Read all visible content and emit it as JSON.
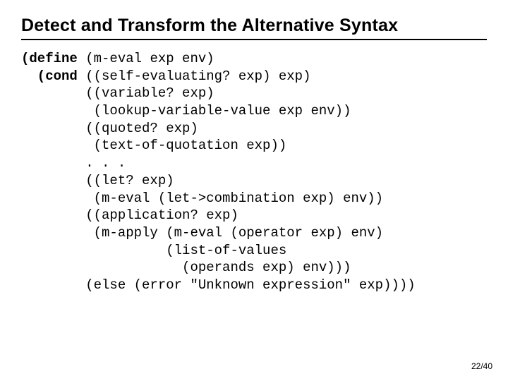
{
  "title": "Detect and Transform the Alternative Syntax",
  "code": {
    "l1a": "(define",
    "l1b": " (m-eval exp env)",
    "l2a": "  (cond",
    "l2b": " ((self-evaluating? exp) exp)",
    "l3": "        ((variable? exp)",
    "l4": "         (lookup-variable-value exp env))",
    "l5": "        ((quoted? exp)",
    "l6": "         (text-of-quotation exp))",
    "l7": "        . . .",
    "l8": "        ((let? exp)",
    "l9": "         (m-eval (let->combination exp) env))",
    "l10": "        ((application? exp)",
    "l11": "         (m-apply (m-eval (operator exp) env)",
    "l12": "                  (list-of-values",
    "l13": "                    (operands exp) env)))",
    "l14": "        (else (error \"Unknown expression\" exp))))"
  },
  "footer": "22/40"
}
